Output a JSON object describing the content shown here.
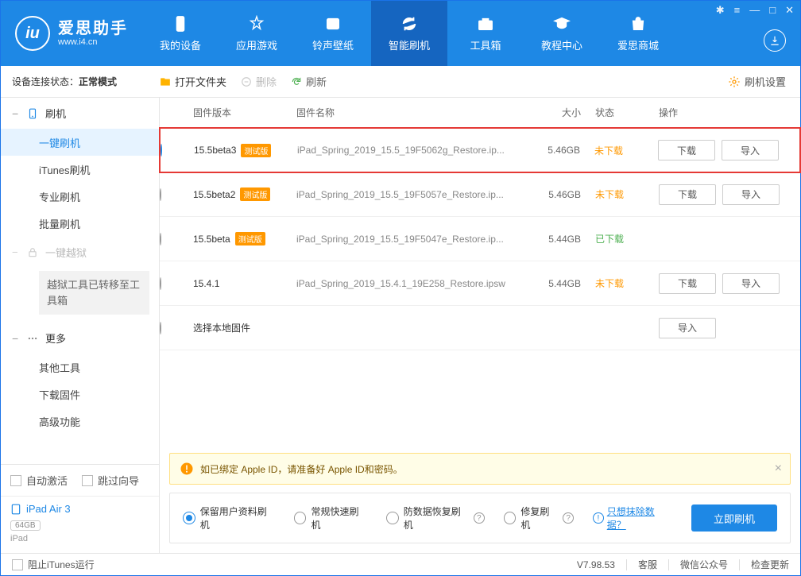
{
  "brand": {
    "cn": "爱思助手",
    "url": "www.i4.cn",
    "logo_letter": "iu"
  },
  "nav": [
    {
      "id": "my-device",
      "label": "我的设备"
    },
    {
      "id": "apps-games",
      "label": "应用游戏"
    },
    {
      "id": "ringtones",
      "label": "铃声壁纸"
    },
    {
      "id": "smart-flash",
      "label": "智能刷机",
      "active": true
    },
    {
      "id": "toolbox",
      "label": "工具箱"
    },
    {
      "id": "tutorial",
      "label": "教程中心"
    },
    {
      "id": "store",
      "label": "爱思商城"
    }
  ],
  "connection": {
    "prefix": "设备连接状态：",
    "value": "正常模式"
  },
  "toolbar": {
    "open_folder": "打开文件夹",
    "delete": "删除",
    "refresh": "刷新",
    "settings": "刷机设置"
  },
  "sidebar": {
    "flash": {
      "head": "刷机",
      "items": [
        {
          "id": "one-click",
          "label": "一键刷机",
          "active": true
        },
        {
          "id": "itunes",
          "label": "iTunes刷机"
        },
        {
          "id": "pro",
          "label": "专业刷机"
        },
        {
          "id": "batch",
          "label": "批量刷机"
        }
      ]
    },
    "jailbreak": {
      "head": "一键越狱",
      "notice": "越狱工具已转移至工具箱"
    },
    "more": {
      "head": "更多",
      "items": [
        {
          "id": "other-tools",
          "label": "其他工具"
        },
        {
          "id": "download-fw",
          "label": "下载固件"
        },
        {
          "id": "advanced",
          "label": "高级功能"
        }
      ]
    },
    "auto_activate": "自动激活",
    "skip_guide": "跳过向导",
    "device": {
      "name": "iPad Air 3",
      "storage": "64GB",
      "type": "iPad"
    }
  },
  "table": {
    "headers": {
      "version": "固件版本",
      "name": "固件名称",
      "size": "大小",
      "status": "状态",
      "action": "操作"
    },
    "btn_download": "下载",
    "btn_import": "导入",
    "status_not": "未下载",
    "status_done": "已下载",
    "badge_beta": "测试版",
    "rows": [
      {
        "selected": true,
        "highlight": true,
        "version": "15.5beta3",
        "beta": true,
        "name": "iPad_Spring_2019_15.5_19F5062g_Restore.ip...",
        "size": "5.46GB",
        "status": "not",
        "download": true,
        "import": true
      },
      {
        "version": "15.5beta2",
        "beta": true,
        "name": "iPad_Spring_2019_15.5_19F5057e_Restore.ip...",
        "size": "5.46GB",
        "status": "not",
        "download": true,
        "import": true
      },
      {
        "version": "15.5beta",
        "beta": true,
        "name": "iPad_Spring_2019_15.5_19F5047e_Restore.ip...",
        "size": "5.44GB",
        "status": "done"
      },
      {
        "version": "15.4.1",
        "name": "iPad_Spring_2019_15.4.1_19E258_Restore.ipsw",
        "size": "5.44GB",
        "status": "not",
        "download": true,
        "import": true
      },
      {
        "version": "选择本地固件",
        "local": true,
        "import": true
      }
    ]
  },
  "warn": "如已绑定 Apple ID，请准备好 Apple ID和密码。",
  "flash_options": {
    "o1": "保留用户资料刷机",
    "o2": "常规快速刷机",
    "o3": "防数据恢复刷机",
    "o4": "修复刷机",
    "erase_link": "只想抹除数据？",
    "go": "立即刷机"
  },
  "statusbar": {
    "stop_itunes": "阻止iTunes运行",
    "version": "V7.98.53",
    "cs": "客服",
    "wechat": "微信公众号",
    "update": "检查更新"
  }
}
